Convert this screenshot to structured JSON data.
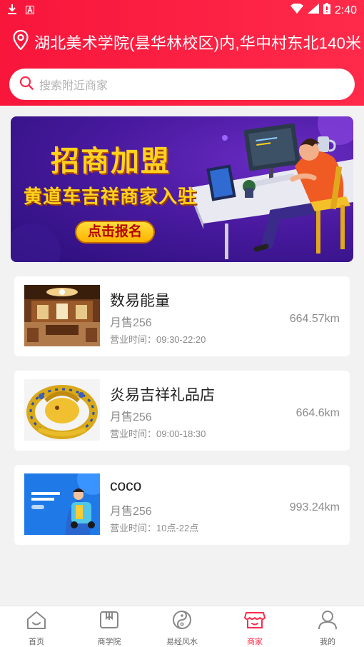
{
  "status_bar": {
    "time": "2:40"
  },
  "location": {
    "text": "湖北美术学院(昙华林校区)内,华中村东北140米"
  },
  "search": {
    "placeholder": "搜索附近商家"
  },
  "banner": {
    "title": "招商加盟",
    "subtitle": "黄道车吉祥商家入驻",
    "button": "点击报名"
  },
  "merchants": [
    {
      "name": "数易能量",
      "sales": "月售256",
      "distance": "664.57km",
      "hours": "营业时间：09:30-22:20",
      "thumb_icon": "tea-room-photo"
    },
    {
      "name": "炎易吉祥礼品店",
      "sales": "月售256",
      "distance": "664.6km",
      "hours": "营业时间：09:00-18:30",
      "thumb_icon": "golden-dragon-photo"
    },
    {
      "name": "coco",
      "sales": "月售256",
      "distance": "993.24km",
      "hours": "营业时间：10点-22点",
      "thumb_icon": "promo-poster-image"
    }
  ],
  "tabs": [
    {
      "label": "首页",
      "icon": "home-icon",
      "active": false
    },
    {
      "label": "商学院",
      "icon": "book-icon",
      "active": false
    },
    {
      "label": "易经风水",
      "icon": "yin-yang-icon",
      "active": false
    },
    {
      "label": "商家",
      "icon": "store-icon",
      "active": true
    },
    {
      "label": "我的",
      "icon": "user-icon",
      "active": false
    }
  ],
  "colors": {
    "brand": "#ff2a4a",
    "header_gradient_start": "#f8163b",
    "banner_text": "#ffd21f"
  }
}
